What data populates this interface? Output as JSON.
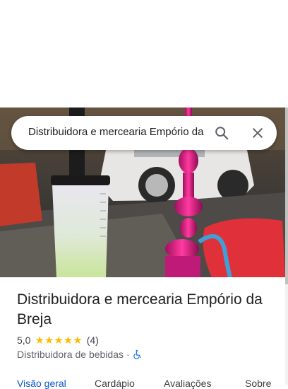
{
  "search": {
    "query": "Distribuidora e mercearia Empório da Breja",
    "search_icon": "search-icon",
    "close_icon": "close-icon"
  },
  "place": {
    "title": "Distribuidora e mercearia Empório da Breja",
    "rating": "5,0",
    "stars": "★★★★★",
    "review_count": "(4)",
    "category": "Distribuidora de bebidas",
    "separator": "·",
    "accessibility_icon": "wheelchair-icon"
  },
  "tabs": [
    {
      "label": "Visão geral"
    },
    {
      "label": "Cardápio"
    },
    {
      "label": "Avaliações"
    },
    {
      "label": "Sobre"
    }
  ],
  "colors": {
    "accent": "#0b57d0",
    "star": "#fbbc04",
    "accessibility": "#1a73e8"
  }
}
